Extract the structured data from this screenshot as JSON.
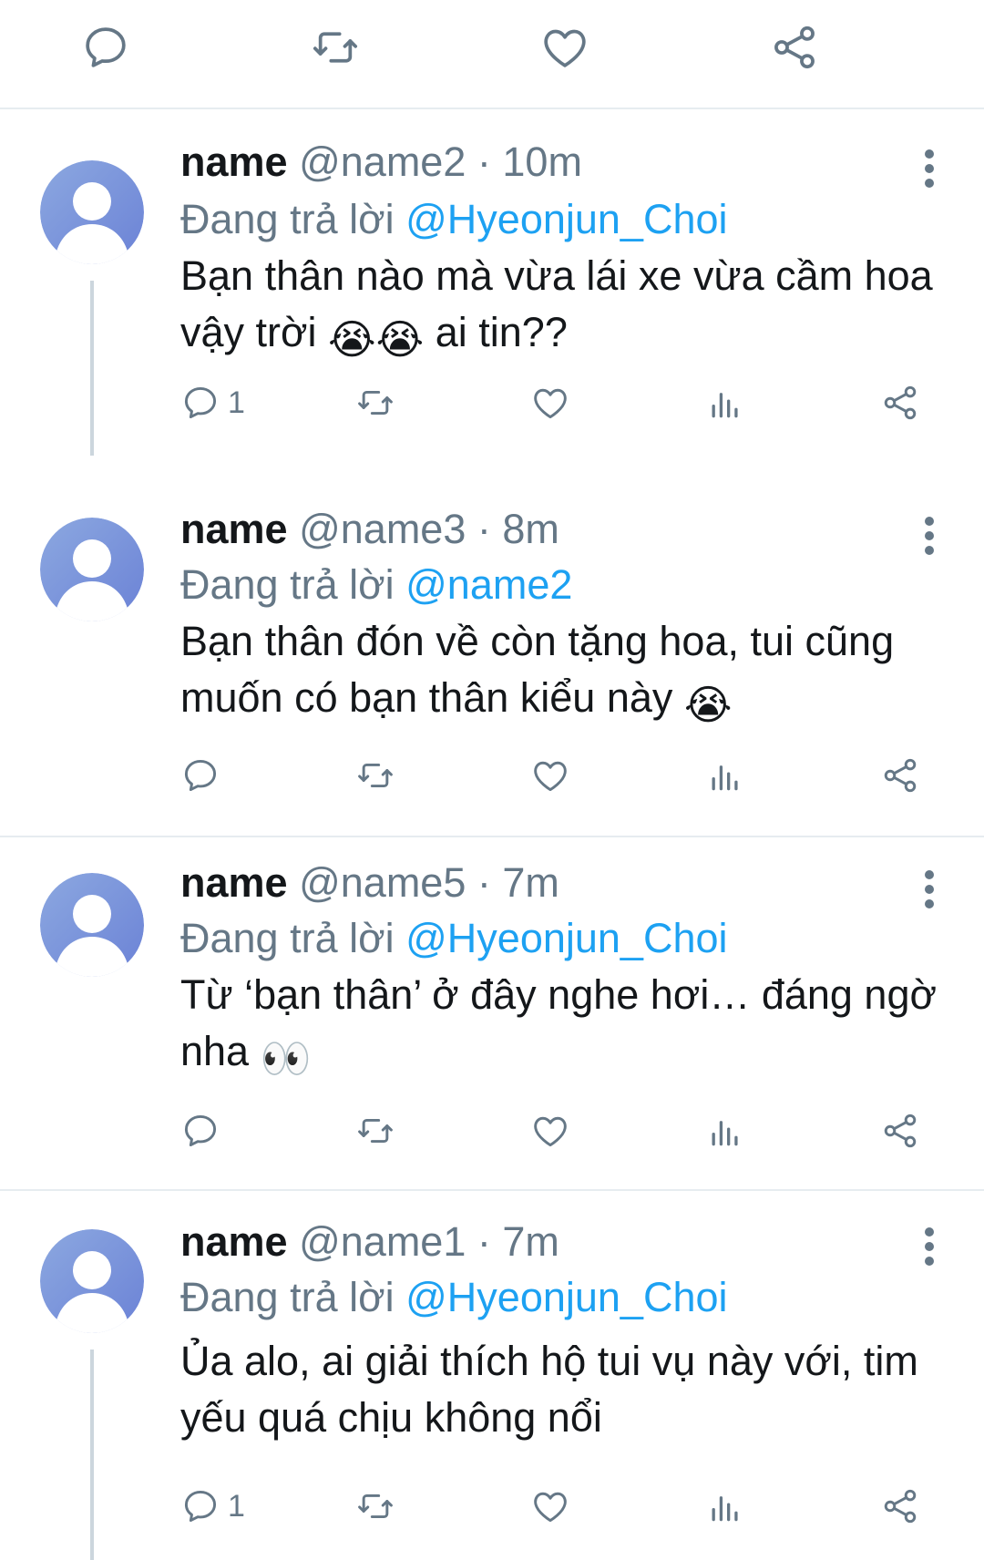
{
  "top_actions": {
    "icons": [
      "reply-icon",
      "retweet-icon",
      "like-icon",
      "share-icon"
    ]
  },
  "colors": {
    "accent": "#1da1f2",
    "secondary_text": "#657786",
    "primary_text": "#14171a",
    "divider": "#e6ecf0",
    "avatar_gradient_start": "#8ca8e0",
    "avatar_gradient_end": "#6b82d6"
  },
  "replying_prefix": "Đang trả lời",
  "replies": [
    {
      "name": "name",
      "handle": "@name2",
      "separator": "·",
      "time": "10m",
      "replying_to": "@Hyeonjun_Choi",
      "text": "Bạn thân nào mà vừa lái xe vừa cầm hoa vậy trời",
      "emoji": "😭😭",
      "text_after": "ai tin??",
      "reply_count": "1"
    },
    {
      "name": "name",
      "handle": "@name3",
      "separator": "·",
      "time": "8m",
      "replying_to": "@name2",
      "text": "Bạn thân đón về còn tặng hoa, tui cũng muốn có bạn thân kiểu này",
      "emoji": "😭",
      "text_after": "",
      "reply_count": ""
    },
    {
      "name": "name",
      "handle": "@name5",
      "separator": "·",
      "time": "7m",
      "replying_to": "@Hyeonjun_Choi",
      "text": "Từ ‘bạn thân’ ở đây nghe hơi… đáng ngờ nha",
      "emoji": "👀",
      "text_after": "",
      "reply_count": ""
    },
    {
      "name": "name",
      "handle": "@name1",
      "separator": "·",
      "time": "7m",
      "replying_to": "@Hyeonjun_Choi",
      "text": "Ủa alo, ai giải thích hộ tui vụ này với, tim yếu quá chịu không nổi",
      "emoji": "",
      "text_after": "",
      "reply_count": "1"
    }
  ]
}
